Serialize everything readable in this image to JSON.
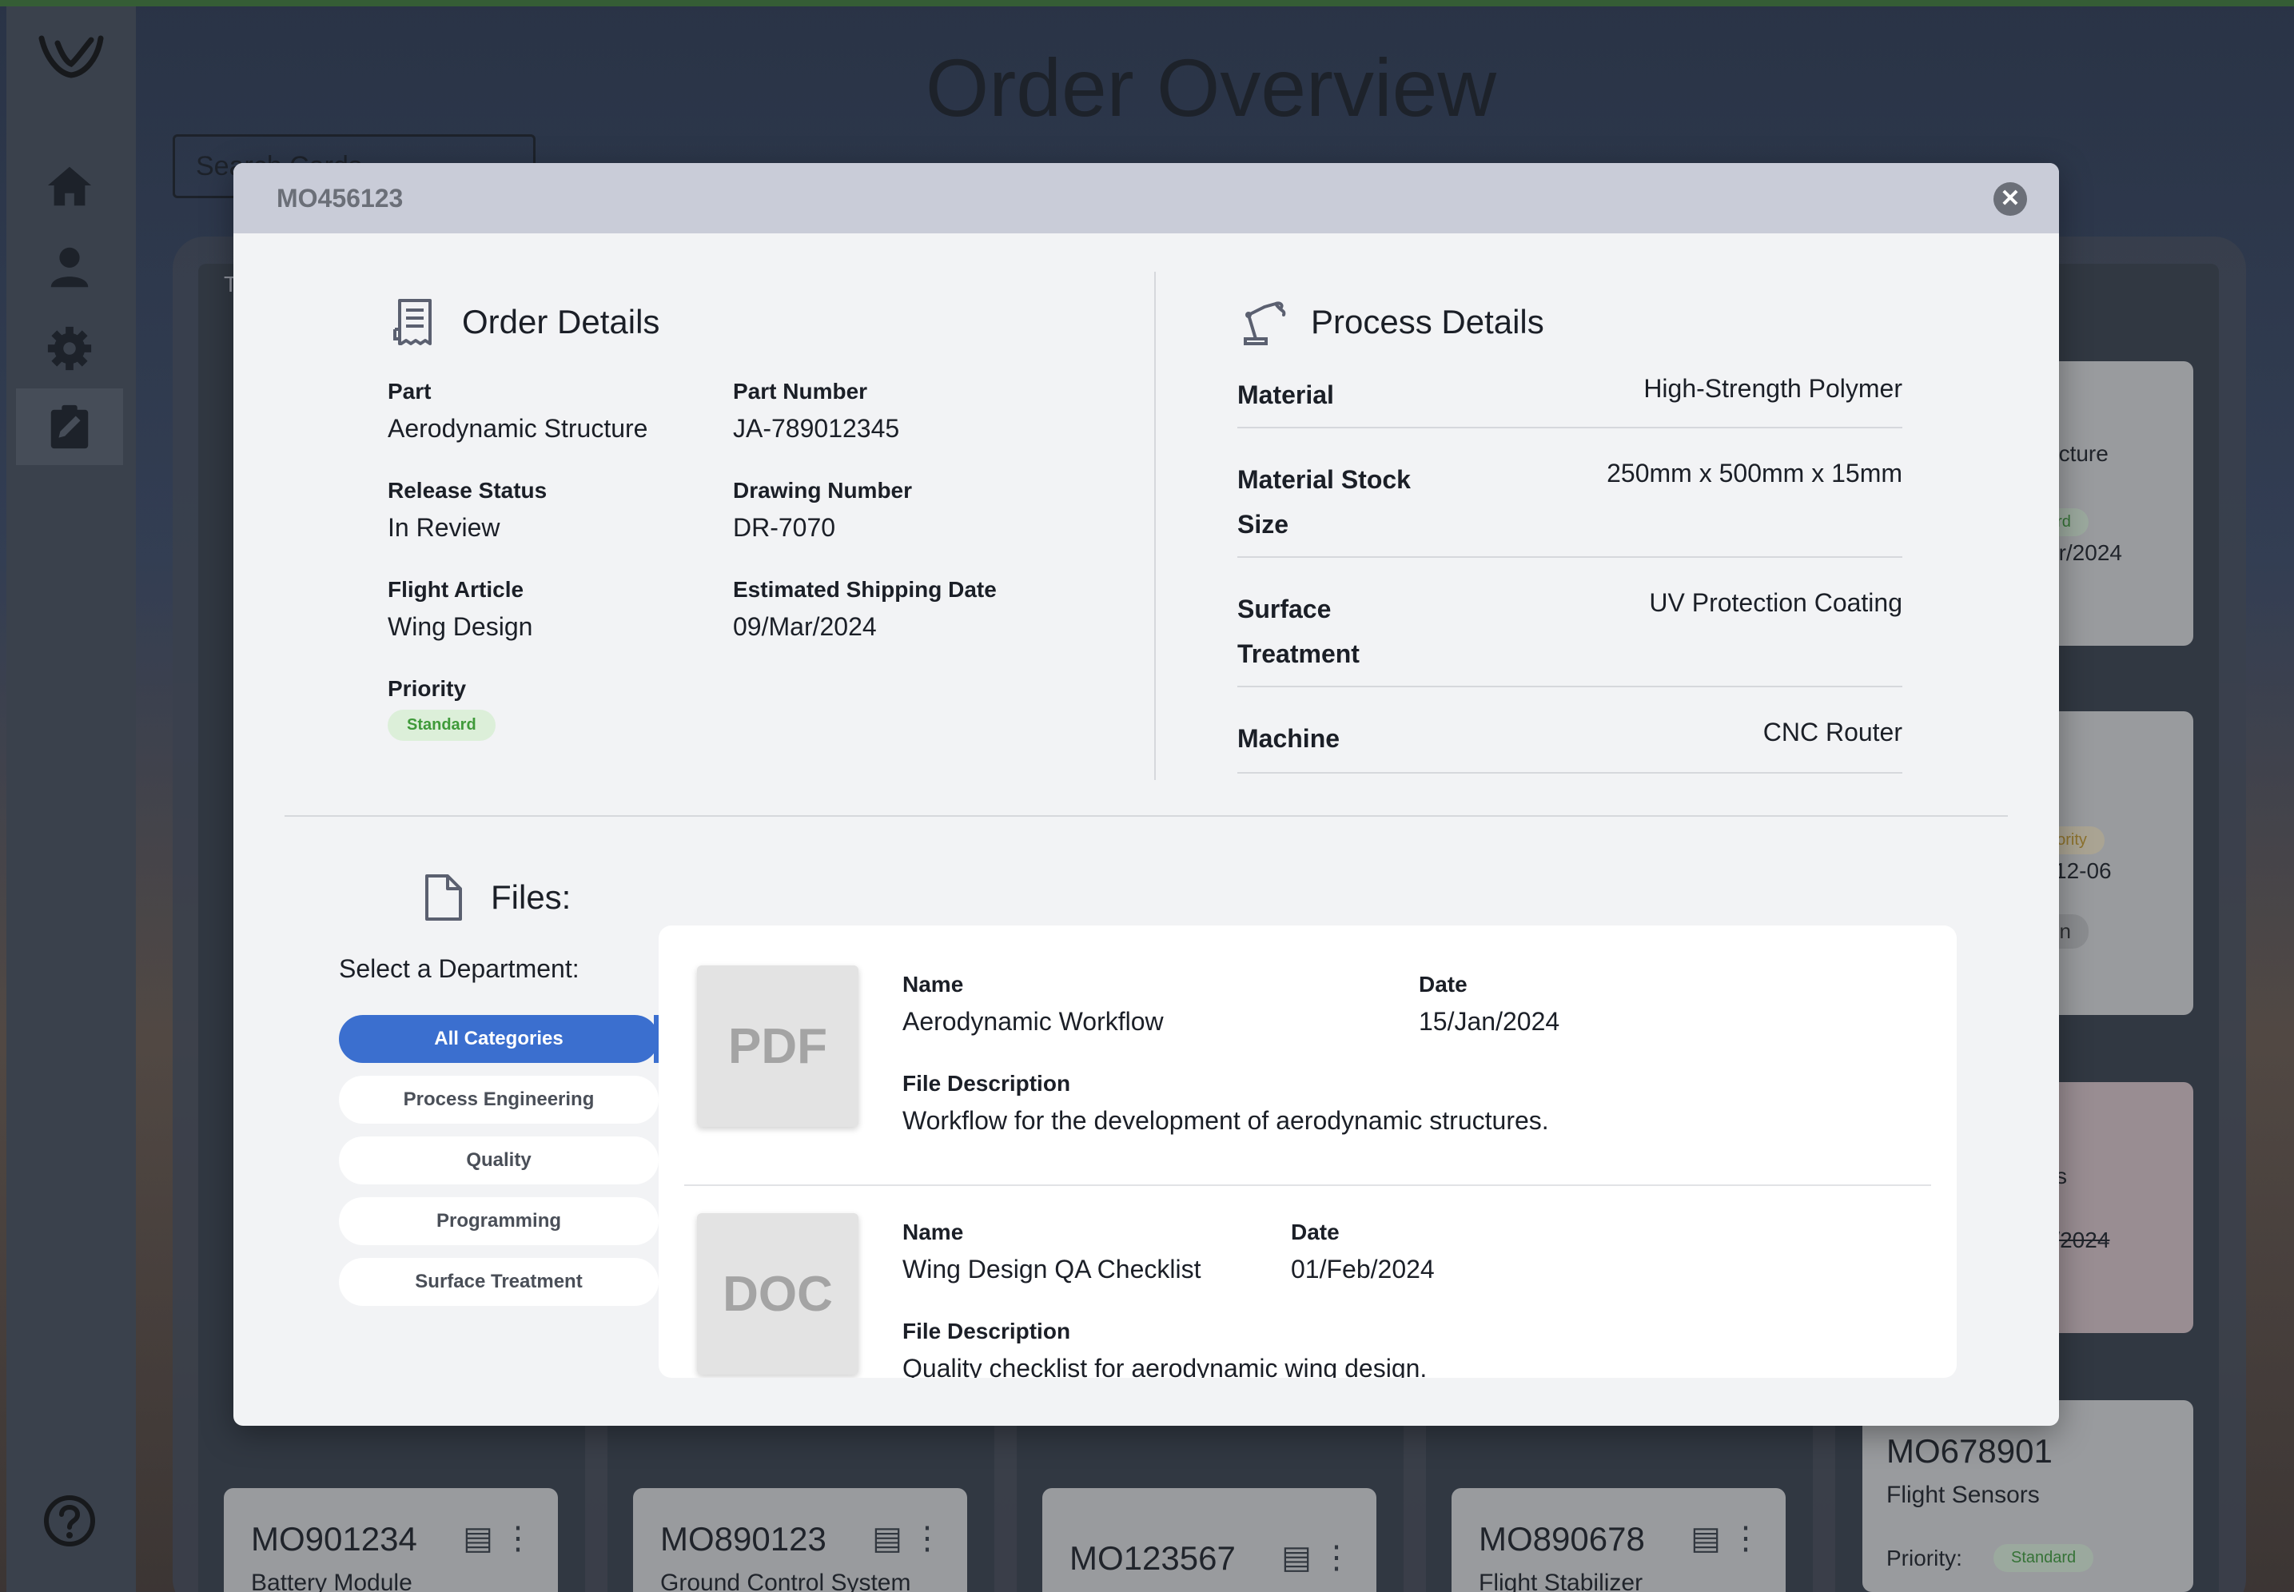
{
  "app": {
    "title": "Order Overview",
    "search_placeholder": "Search Cards"
  },
  "background_cards": [
    {
      "id": "MO901234",
      "subtitle": "Battery Module"
    },
    {
      "id": "MO890123",
      "subtitle": "Ground Control System"
    },
    {
      "id": "MO123567",
      "subtitle": ""
    },
    {
      "id": "MO890678",
      "subtitle": "Flight Stabilizer"
    },
    {
      "id": "MO678901",
      "subtitle": "Flight Sensors",
      "priority_label": "Priority:",
      "priority": "Standard"
    }
  ],
  "background_fragments": {
    "f1": "ucture",
    "f2": "ard",
    "f3": "ar/2024",
    "f4": "riority",
    "f5": "12-06",
    "f6": "on",
    "f7": "s",
    "f8": "r/2024",
    "col_label": "T"
  },
  "modal": {
    "title": "MO456123",
    "close_symbol": "✕",
    "order_details": {
      "heading": "Order Details",
      "part_label": "Part",
      "part": "Aerodynamic Structure",
      "part_number_label": "Part Number",
      "part_number": "JA-789012345",
      "release_status_label": "Release Status",
      "release_status": "In Review",
      "drawing_number_label": "Drawing Number",
      "drawing_number": "DR-7070",
      "flight_article_label": "Flight Article",
      "flight_article": "Wing Design",
      "shipping_label": "Estimated Shipping Date",
      "shipping_date": "09/Mar/2024",
      "priority_label": "Priority",
      "priority": "Standard"
    },
    "process_details": {
      "heading": "Process Details",
      "rows": [
        {
          "label": "Material",
          "value": "High-Strength Polymer"
        },
        {
          "label": "Material Stock Size",
          "value": "250mm x 500mm x 15mm"
        },
        {
          "label": "Surface Treatment",
          "value": "UV Protection Coating"
        },
        {
          "label": "Machine",
          "value": "CNC Router"
        }
      ]
    },
    "files": {
      "heading": "Files:",
      "select_label": "Select a Department:",
      "departments": [
        "All Categories",
        "Process Engineering",
        "Quality",
        "Programming",
        "Surface Treatment"
      ],
      "active_department": "All Categories",
      "name_label": "Name",
      "date_label": "Date",
      "description_label": "File Description",
      "items": [
        {
          "type": "PDF",
          "name": "Aerodynamic Workflow",
          "date": "15/Jan/2024",
          "description": "Workflow for the development of aerodynamic structures."
        },
        {
          "type": "DOC",
          "name": "Wing Design QA Checklist",
          "date": "01/Feb/2024",
          "description": "Quality checklist for aerodynamic wing design."
        }
      ]
    }
  },
  "colors": {
    "accent": "#3b6fcf",
    "header": "#c9ccd8",
    "standard_bg": "#dcefd9",
    "standard_text": "#3f9a3a"
  }
}
